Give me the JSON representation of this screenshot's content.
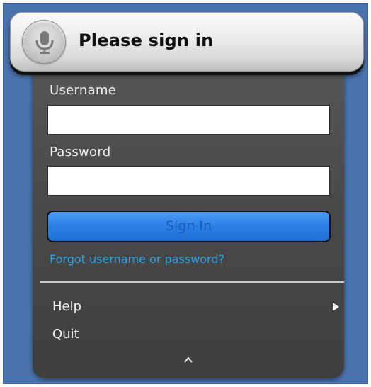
{
  "header": {
    "title": "Please sign in",
    "mic_icon": "microphone-icon"
  },
  "form": {
    "username_label": "Username",
    "username_value": "",
    "password_label": "Password",
    "password_value": "",
    "signin_label": "Sign In",
    "forgot_link": "Forgot username or password?"
  },
  "menu": {
    "items": [
      {
        "label": "Help",
        "icon": "chevron-right-icon"
      },
      {
        "label": "Quit"
      }
    ],
    "collapse_icon": "caret-up-icon"
  },
  "colors": {
    "background": "#4a72ad",
    "panel": "#49494a",
    "accent": "#2a7fe6",
    "link": "#2aa3e6"
  }
}
